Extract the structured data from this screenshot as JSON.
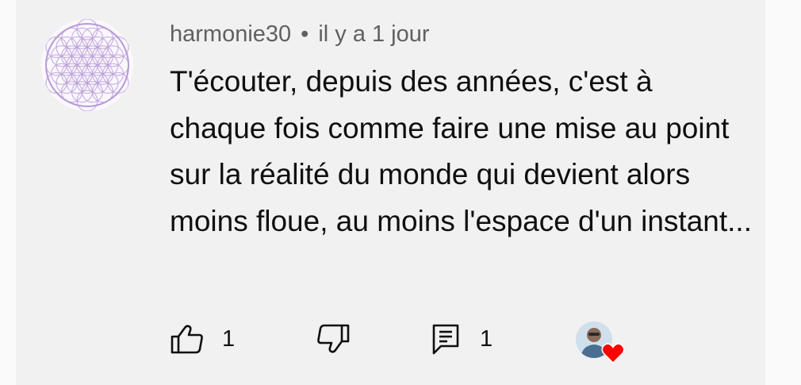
{
  "comment": {
    "author": "harmonie30",
    "separator": "•",
    "timestamp": "il y a 1 jour",
    "text": "T'écouter, depuis des années, c'est à chaque fois comme faire une mise au point sur la réalité du monde qui devient alors moins floue, au moins l'espace d'un instant...",
    "avatar_icon": "flower-of-life-icon",
    "avatar_color": "#b79ad6"
  },
  "actions": {
    "like_icon": "thumb-up-icon",
    "like_count": "1",
    "dislike_icon": "thumb-down-icon",
    "reply_icon": "comment-icon",
    "reply_count": "1",
    "creator_heart_icon": "heart-icon",
    "heart_color": "#ff0000"
  }
}
